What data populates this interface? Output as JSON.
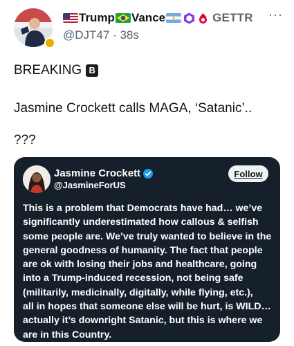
{
  "post": {
    "author_name": "Trump",
    "author_name_2": "Vance",
    "platform_tag": "GETTR",
    "handle": "@DJT47",
    "time": "38s",
    "breaking_label": "BREAKING",
    "breaking_badge": "B",
    "paragraph": "Jasmine Crockett calls MAGA, ‘Satanic’..",
    "question": "???",
    "more_label": "···"
  },
  "quote": {
    "name": "Jasmine Crockett",
    "handle": "@JasmineForUS",
    "follow_label": "Follow",
    "text": "This is a problem that Democrats have had… we’ve\nsignificantly underestimated how callous & selfish\nsome people are. We’ve truly wanted to believe in the\ngeneral goodness of humanity. The fact that people\nare ok with losing their jobs and healthcare, going\ninto a Trump-induced recession, not being safe\n(militarily, medicinally, digitally, while flying, etc.),\nall in hopes that someone else will be hurt, is WILD…\nactually it’s downright Satanic, but this is where we\nare in this Country."
  },
  "icons": {
    "avatar_badge": "gold-badge-icon",
    "us_flag": "us-flag-icon",
    "brazil_flag": "brazil-flag-icon",
    "argentina_flag": "argentina-flag-icon",
    "hexagon": "purple-hexagon-icon",
    "gettr": "gettr-logo-icon",
    "verified": "verified-badge-icon",
    "more": "more-options-icon"
  },
  "colors": {
    "card_bg": "#15202b",
    "verified": "#1d9bf0",
    "secondary_text": "#536471",
    "gettr_red": "#e4003b"
  }
}
